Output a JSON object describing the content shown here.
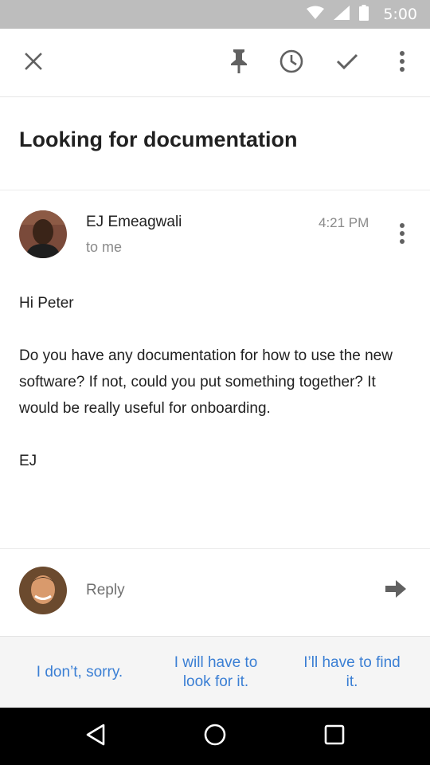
{
  "status_bar": {
    "time": "5:00"
  },
  "toolbar": {
    "close": "close-icon",
    "pin": "pin-icon",
    "snooze": "clock-icon",
    "done": "check-icon",
    "more": "more-vert-icon"
  },
  "email": {
    "subject": "Looking for documentation",
    "sender": "EJ Emeagwali",
    "recipient": "to me",
    "time": "4:21 PM",
    "greeting": "Hi Peter",
    "body": "Do you have any documentation for how to use the new software? If not, could you put something together? It would be really useful for onboarding.",
    "signature": "EJ"
  },
  "reply": {
    "placeholder": "Reply"
  },
  "smart_replies": [
    {
      "label": "I don’t, sorry."
    },
    {
      "label": "I will have to look for it."
    },
    {
      "label": "I’ll have to find it."
    }
  ],
  "colors": {
    "accent": "#3b7fd4",
    "status_bar": "#bdbdbd",
    "icon": "#616161"
  }
}
